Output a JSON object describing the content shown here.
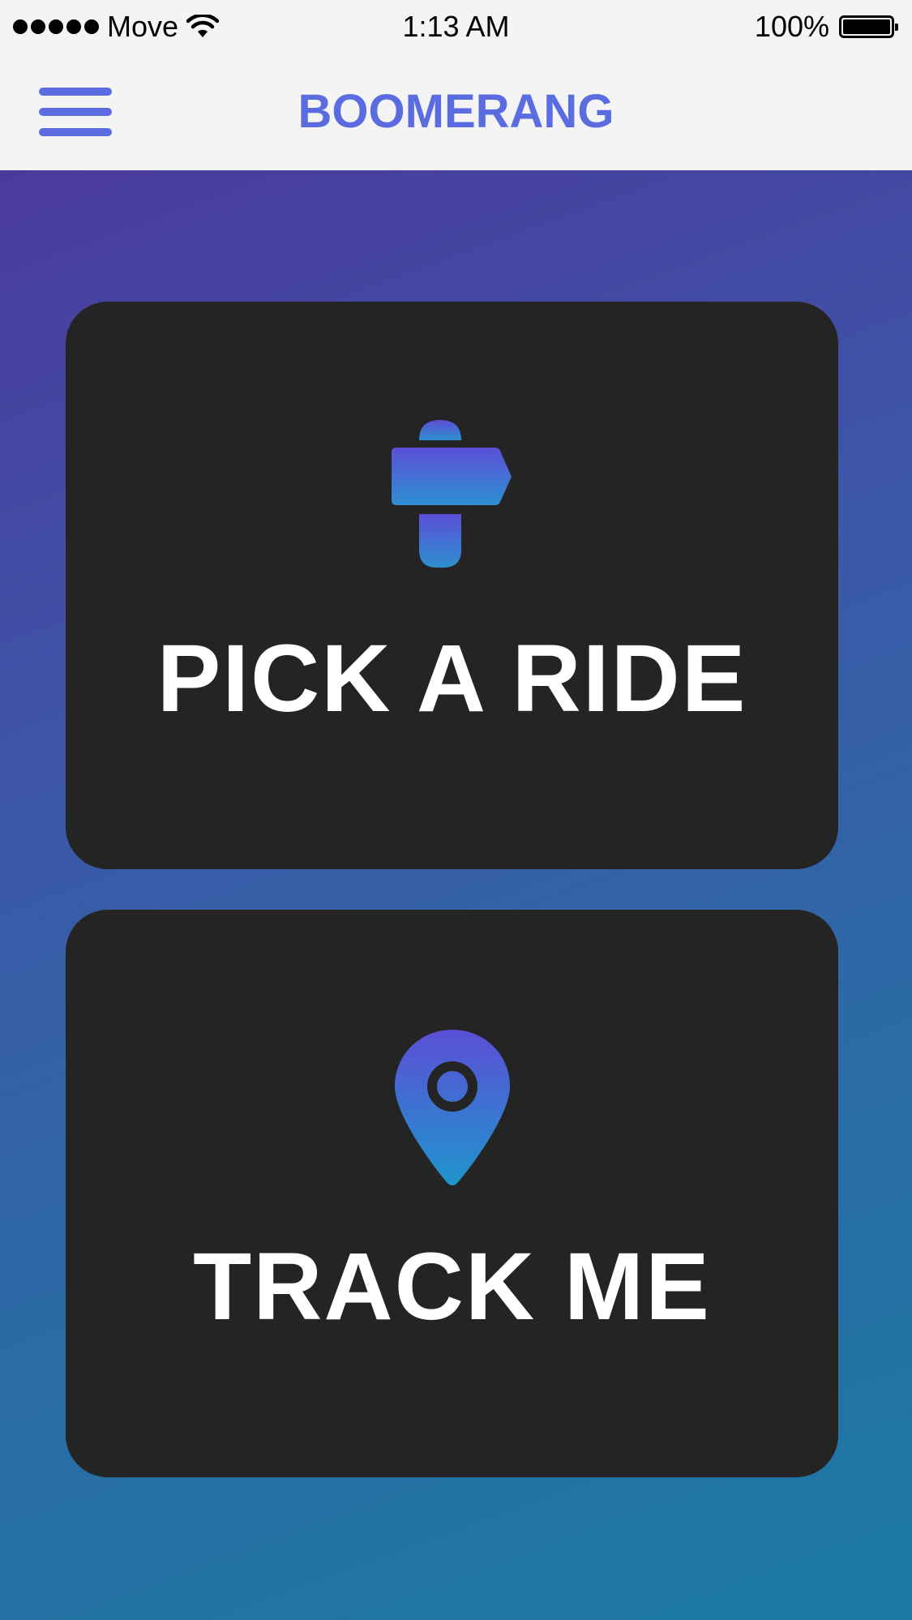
{
  "status_bar": {
    "carrier": "Move",
    "time": "1:13 AM",
    "battery": "100%",
    "battery_level": 1.0,
    "icons": [
      "signal-dots-icon",
      "wifi-icon",
      "battery-icon"
    ]
  },
  "nav": {
    "title": "BOOMERANG",
    "menu_icon": "hamburger-menu-icon"
  },
  "cards": {
    "ride": {
      "label": "PICK A RIDE",
      "icon": "signpost-icon"
    },
    "track": {
      "label": "TRACK ME",
      "icon": "map-pin-icon"
    }
  },
  "colors": {
    "accent": "#5b6ce0",
    "card_bg": "#242424",
    "gradient_start": "#4a3a9c",
    "gradient_end": "#1b7aa3",
    "icon_gradient_top": "#5b4fd6",
    "icon_gradient_bottom": "#1f95cc"
  }
}
